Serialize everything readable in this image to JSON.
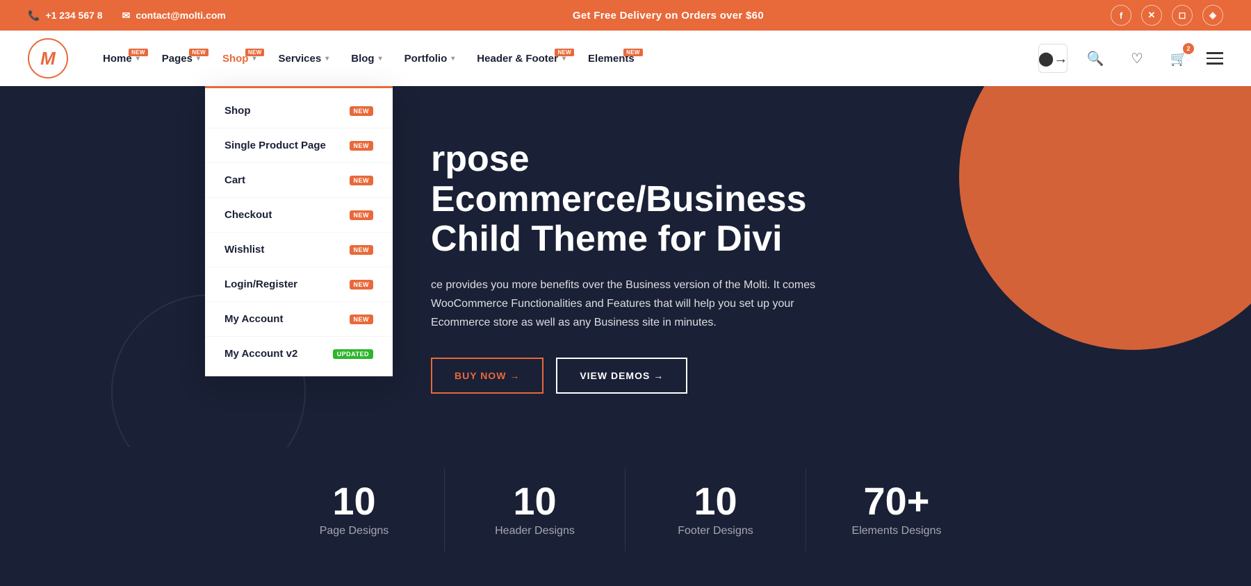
{
  "topbar": {
    "phone": "+1 234 567 8",
    "email": "contact@molti.com",
    "promo": "Get Free Delivery on Orders over $60",
    "socials": [
      "f",
      "✕",
      "◻",
      "◈"
    ]
  },
  "header": {
    "logo_letter": "M",
    "nav": [
      {
        "label": "Home",
        "badge": "NEW",
        "has_chevron": true
      },
      {
        "label": "Pages",
        "badge": "NEW",
        "has_chevron": true
      },
      {
        "label": "Shop",
        "badge": "NEW",
        "has_chevron": true
      },
      {
        "label": "Services",
        "badge": "",
        "has_chevron": true
      },
      {
        "label": "Blog",
        "badge": "",
        "has_chevron": true
      },
      {
        "label": "Portfolio",
        "badge": "",
        "has_chevron": true
      },
      {
        "label": "Header & Footer",
        "badge": "NEW",
        "has_chevron": true
      },
      {
        "label": "Elements",
        "badge": "NEW",
        "has_chevron": false
      }
    ],
    "cart_count": "2"
  },
  "dropdown": {
    "items": [
      {
        "label": "Shop",
        "badge": "NEW",
        "badge_type": "new"
      },
      {
        "label": "Single Product Page",
        "badge": "NEW",
        "badge_type": "new"
      },
      {
        "label": "Cart",
        "badge": "NEW",
        "badge_type": "new"
      },
      {
        "label": "Checkout",
        "badge": "NEW",
        "badge_type": "new"
      },
      {
        "label": "Wishlist",
        "badge": "NEW",
        "badge_type": "new"
      },
      {
        "label": "Login/Register",
        "badge": "NEW",
        "badge_type": "new"
      },
      {
        "label": "My Account",
        "badge": "NEW",
        "badge_type": "new"
      },
      {
        "label": "My Account v2",
        "badge": "UPDATED",
        "badge_type": "updated"
      }
    ]
  },
  "hero": {
    "title_line1": "rpose Ecommerce/Business",
    "title_line2": "Child Theme for Divi",
    "description": "ce provides you more benefits over the Business version of the Molti. It comes\nWooCommerce Functionalities and Features that will help you set up your\nEcommerce store as well as any Business site in minutes.",
    "btn_buy": "BUY NOW →",
    "btn_demos": "VIEW DEMOS →"
  },
  "stats": [
    {
      "number": "10",
      "label": "Page Designs"
    },
    {
      "number": "10",
      "label": "Header Designs"
    },
    {
      "number": "10",
      "label": "Footer Designs"
    },
    {
      "number": "70+",
      "label": "Elements Designs"
    }
  ],
  "colors": {
    "accent": "#e8693a",
    "dark": "#1a2035",
    "green": "#2db52d"
  }
}
